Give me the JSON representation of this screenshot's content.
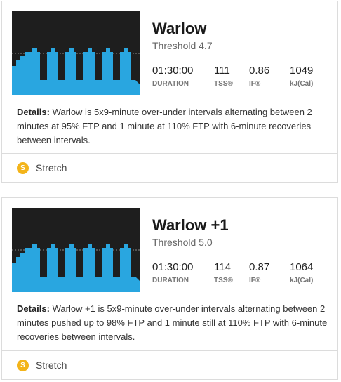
{
  "colors": {
    "profile_bg": "#1e1e1e",
    "interval_fill": "#29a6e0",
    "badge": "#f3b41a"
  },
  "workouts": [
    {
      "title": "Warlow",
      "subtitle": "Threshold 4.7",
      "duration_value": "01:30:00",
      "duration_label": "DURATION",
      "tss_value": "111",
      "tss_label": "TSS®",
      "if_value": "0.86",
      "if_label": "IF®",
      "kj_value": "1049",
      "kj_label": "kJ(Cal)",
      "details_label": "Details:",
      "details_text": "Warlow is 5x9-minute over-under intervals alternating between 2 minutes at 95% FTP and 1 minute at 110% FTP with 6-minute recoveries between intervals.",
      "stretch_badge": "S",
      "stretch_label": "Stretch"
    },
    {
      "title": "Warlow +1",
      "subtitle": "Threshold 5.0",
      "duration_value": "01:30:00",
      "duration_label": "DURATION",
      "tss_value": "114",
      "tss_label": "TSS®",
      "if_value": "0.87",
      "if_label": "IF®",
      "kj_value": "1064",
      "kj_label": "kJ(Cal)",
      "details_label": "Details:",
      "details_text": "Warlow +1 is 5x9-minute over-under intervals alternating between 2 minutes pushed up to 98% FTP and 1 minute still at 110% FTP with 6-minute recoveries between intervals.",
      "stretch_badge": "S",
      "stretch_label": "Stretch"
    }
  ]
}
